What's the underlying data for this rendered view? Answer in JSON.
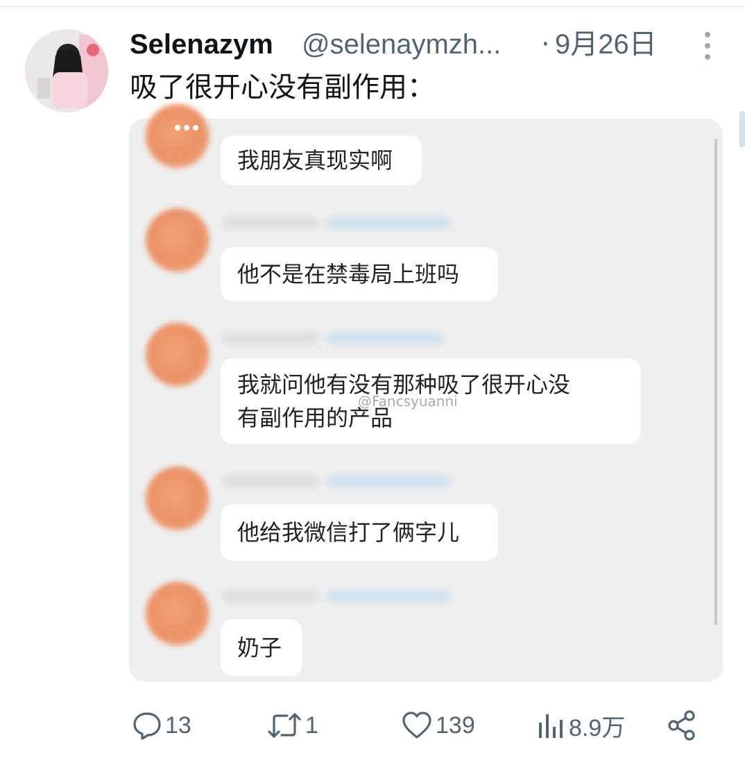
{
  "post": {
    "display_name": "Selenazym",
    "handle": "@selenaymzh...",
    "date_separator": "·",
    "date": "9月26日",
    "text": "吸了很开心没有副作用："
  },
  "image": {
    "messages": [
      {
        "lines": [
          "我朋友真现实啊"
        ]
      },
      {
        "lines": [
          "他不是在禁毒局上班吗"
        ]
      },
      {
        "lines": [
          "我就问他有没有那种吸了很开心没",
          "有副作用的产品"
        ]
      },
      {
        "lines": [
          "他给我微信打了俩字儿"
        ]
      },
      {
        "lines": [
          "奶子"
        ]
      }
    ],
    "watermark": "@Fancsyuanni"
  },
  "actions": {
    "replies": "13",
    "reposts": "1",
    "likes": "139",
    "views": "8.9万"
  },
  "icons": {
    "more": "more-vertical-icon",
    "reply": "reply-icon",
    "repost": "repost-icon",
    "like": "heart-icon",
    "views": "views-chart-icon",
    "share": "share-icon"
  },
  "colors": {
    "text_primary": "#0f1419",
    "text_secondary": "#536471",
    "chat_avatar": "#eb9166"
  }
}
